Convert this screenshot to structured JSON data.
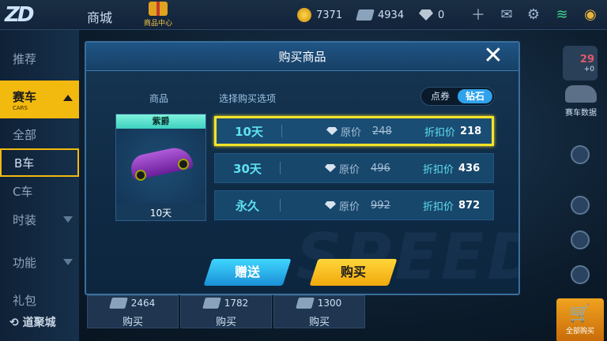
{
  "topbar": {
    "shop_title": "商城",
    "gift_center_label": "商品中心",
    "coins": "7371",
    "tickets": "4934",
    "gems": "0"
  },
  "sidebar": {
    "items": [
      {
        "label": "推荐"
      },
      {
        "label": "赛车",
        "sub": "CARS"
      },
      {
        "label": "全部"
      },
      {
        "label": "B车"
      },
      {
        "label": "C车"
      },
      {
        "label": "时装"
      },
      {
        "label": "功能"
      },
      {
        "label": "礼包"
      }
    ],
    "brand": "道聚城"
  },
  "right": {
    "shirt_level": "29",
    "shirt_plus": "+0",
    "race_data_label": "赛车数据",
    "cart_label": "全部购买"
  },
  "behind_items": [
    {
      "price": "2464",
      "buy": "购买"
    },
    {
      "price": "1782",
      "buy": "购买"
    },
    {
      "price": "1300",
      "buy": "购买"
    }
  ],
  "modal": {
    "title": "购买商品",
    "goods_label": "商品",
    "options_label": "选择购买选项",
    "toggle": {
      "left": "点券",
      "right": "钻石",
      "selected": "钻石"
    },
    "product": {
      "name": "紫爵",
      "duration": "10天"
    },
    "options": [
      {
        "days": "10天",
        "orig_label": "原价",
        "orig": "248",
        "disc_label": "折扣价",
        "disc": "218",
        "selected": true
      },
      {
        "days": "30天",
        "orig_label": "原价",
        "orig": "496",
        "disc_label": "折扣价",
        "disc": "436",
        "selected": false
      },
      {
        "days": "永久",
        "orig_label": "原价",
        "orig": "992",
        "disc_label": "折扣价",
        "disc": "872",
        "selected": false
      }
    ],
    "gift_button": "赠送",
    "buy_button": "购买",
    "watermark": "SPEED"
  }
}
